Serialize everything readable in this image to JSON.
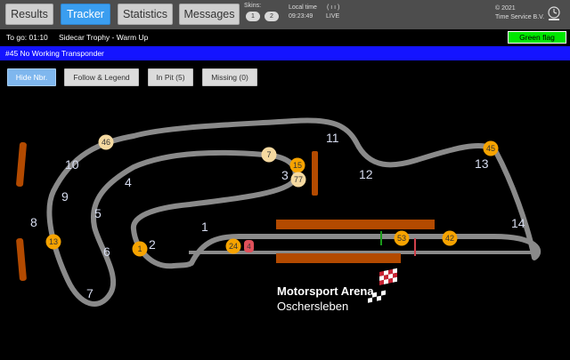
{
  "nav": {
    "results": "Results",
    "tracker": "Tracker",
    "statistics": "Statistics",
    "messages": "Messages"
  },
  "skins": {
    "label": "Skins:",
    "options": [
      "1",
      "2"
    ]
  },
  "clock": {
    "label": "Local time",
    "time": "09:23:49",
    "signal": "( ı ı )",
    "status": "LIVE"
  },
  "copyright": {
    "line1": "© 2021",
    "line2": "Time Service B.V."
  },
  "session": {
    "countdown": "To go: 01:10",
    "name": "Sidecar Trophy - Warm Up",
    "flag": "Green flag"
  },
  "message": "#45 No Working Transponder",
  "tracker_buttons": {
    "hide_nbr": "Hide Nbr.",
    "follow_legend": "Follow & Legend",
    "in_pit": "In Pit (5)",
    "missing": "Missing (0)"
  },
  "track": {
    "logo_line1": "Motorsport Arena",
    "logo_line2": "Oschersleben",
    "corners": [
      "1",
      "2",
      "3",
      "4",
      "5",
      "6",
      "7",
      "8",
      "9",
      "10",
      "11",
      "12",
      "13",
      "14"
    ]
  },
  "competitors": [
    "46",
    "7",
    "15",
    "77",
    "45",
    "13",
    "1",
    "24",
    "4",
    "53",
    "42"
  ],
  "colors": {
    "accent": "#3a9ef0",
    "flag_green": "#00e600",
    "message_blue": "#1414ff",
    "pit_wall": "#b34a00",
    "marker_orange": "#f6a300",
    "marker_light": "#f5d9a0",
    "marker_red": "#e0505a"
  }
}
